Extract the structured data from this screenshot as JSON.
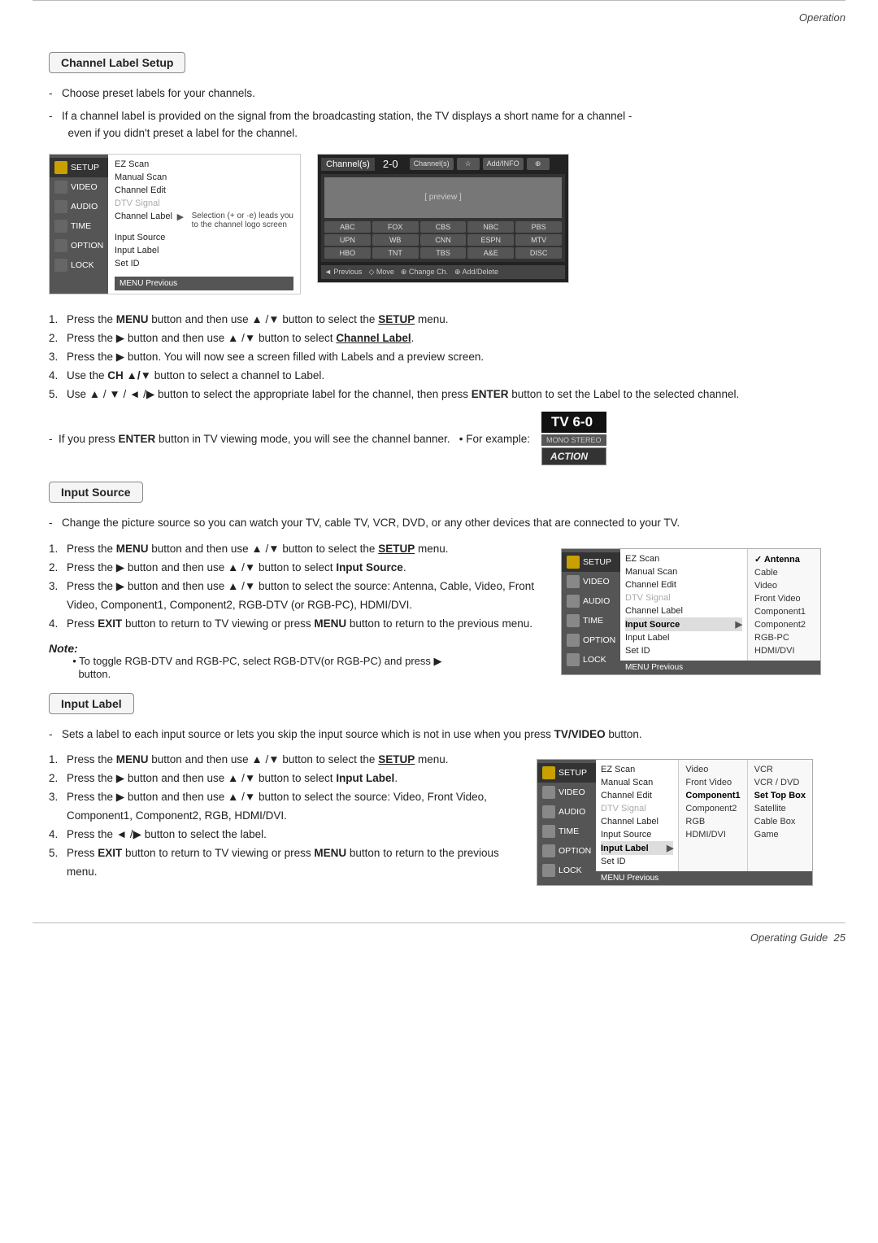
{
  "header": {
    "operation_label": "Operation"
  },
  "footer": {
    "page_label": "Operating Guide",
    "page_number": "25"
  },
  "channel_label_setup": {
    "title": "Channel Label Setup",
    "bullets": [
      "Choose preset labels for your channels.",
      "If a channel label is provided on the signal from the broadcasting station, the TV displays a short name for a channel - even if you didn't preset a label for the channel."
    ],
    "menu_sidebar_items": [
      {
        "label": "SETUP",
        "icon": "setup",
        "active": true
      },
      {
        "label": "VIDEO",
        "icon": "video"
      },
      {
        "label": "AUDIO",
        "icon": "audio"
      },
      {
        "label": "TIME",
        "icon": "time"
      },
      {
        "label": "OPTION",
        "icon": "option"
      },
      {
        "label": "LOCK",
        "icon": "lock"
      }
    ],
    "menu_items": [
      {
        "label": "EZ Scan",
        "dimmed": false
      },
      {
        "label": "Manual Scan",
        "dimmed": false
      },
      {
        "label": "Channel Edit",
        "dimmed": false
      },
      {
        "label": "DTV Signal",
        "dimmed": true
      },
      {
        "label": "Channel Label",
        "dimmed": false,
        "arrow": true,
        "note": "Selection (+ or -) leads you to the channel logo screen"
      },
      {
        "label": "Input Source",
        "dimmed": false
      },
      {
        "label": "Input Label",
        "dimmed": false
      },
      {
        "label": "Set ID",
        "dimmed": false
      }
    ],
    "menu_bottom": "MENU Previous",
    "steps": [
      {
        "num": "1.",
        "text": "Press the ",
        "bold_parts": [
          "MENU"
        ],
        "rest": " button and then use ▲ /▼ button to select the ",
        "bold_end": "SETUP",
        "end": " menu."
      },
      {
        "num": "2.",
        "text": "Press the ▶ button and then use ▲ /▼ button to select ",
        "bold_end": "Channel Label",
        "end": "."
      },
      {
        "num": "3.",
        "text": "Press the ▶ button. You will now see a screen filled with Labels and a preview screen."
      },
      {
        "num": "4.",
        "text": "Use the ",
        "bold_parts": [
          "CH ▲/▼"
        ],
        "rest": " button to select a channel to Label."
      },
      {
        "num": "5.",
        "text": "Use ▲ / ▼ / ◄ /▶ button to select the appropriate label for the channel, then press ",
        "bold_end": "ENTER",
        "end": " button to set the Label to the selected channel."
      }
    ],
    "enter_note": "If you press ENTER button in TV viewing mode, you will see the channel banner.    • For example:",
    "tv_example": "TV 6-0",
    "tv_mono_stereo": "MONO STEREO",
    "tv_action": "ACTION"
  },
  "input_source": {
    "title": "Input Source",
    "bullet": "Change the picture source so you can watch your TV, cable TV, VCR, DVD, or any other devices that are connected to your TV.",
    "steps": [
      "Press the MENU button and then use ▲ /▼ button to select the SETUP menu.",
      "Press the ▶ button and then use ▲ /▼ button to select Input Source.",
      "Press the ▶ button and then use ▲ /▼ button to select the source: Antenna, Cable, Video, Front Video, Component1, Component2, RGB-DTV (or RGB-PC), HDMI/DVI.",
      "Press EXIT button to return to TV viewing or press MENU button to return to the previous menu."
    ],
    "note_label": "Note:",
    "note_text": "• To toggle RGB-DTV and RGB-PC, select RGB-DTV(or RGB-PC) and press ▶ button.",
    "menu_sidebar_items": [
      {
        "label": "SETUP",
        "icon": "setup",
        "active": true
      },
      {
        "label": "VIDEO",
        "icon": "video"
      },
      {
        "label": "AUDIO",
        "icon": "audio"
      },
      {
        "label": "TIME",
        "icon": "time"
      },
      {
        "label": "OPTION",
        "icon": "option"
      },
      {
        "label": "LOCK",
        "icon": "lock"
      }
    ],
    "menu_items": [
      {
        "label": "EZ Scan"
      },
      {
        "label": "Manual Scan"
      },
      {
        "label": "Channel Edit"
      },
      {
        "label": "DTV Signal",
        "dimmed": true
      },
      {
        "label": "Channel Label"
      },
      {
        "label": "Input Source",
        "highlighted": true,
        "arrow": true
      },
      {
        "label": "Input Label"
      },
      {
        "label": "Set ID"
      }
    ],
    "options": [
      {
        "label": "✓ Antenna",
        "checked": true
      },
      {
        "label": "Cable"
      },
      {
        "label": "Video"
      },
      {
        "label": "Front Video"
      },
      {
        "label": "Component1"
      },
      {
        "label": "Component2"
      },
      {
        "label": "RGB-PC"
      },
      {
        "label": "HDMI/DVI"
      }
    ],
    "menu_bottom": "MENU Previous"
  },
  "input_label": {
    "title": "Input Label",
    "bullets": [
      "Sets a label to each input source or lets you skip the input source which is not in use when you press TV/VIDEO button."
    ],
    "steps": [
      "Press the MENU button and then use ▲ /▼ button to select the SETUP menu.",
      "Press the ▶ button and then use ▲ /▼ button to select Input Label.",
      "Press the ▶ button and then use ▲ /▼ button to select the source: Video, Front Video, Component1, Component2, RGB, HDMI/DVI.",
      "Press the ◄ /▶ button to select the label.",
      "Press EXIT button to return to TV viewing or press MENU button to return to the previous menu."
    ],
    "menu_sidebar_items": [
      {
        "label": "SETUP",
        "icon": "setup",
        "active": true
      },
      {
        "label": "VIDEO",
        "icon": "video"
      },
      {
        "label": "AUDIO",
        "icon": "audio"
      },
      {
        "label": "TIME",
        "icon": "time"
      },
      {
        "label": "OPTION",
        "icon": "option"
      },
      {
        "label": "LOCK",
        "icon": "lock"
      }
    ],
    "menu_items": [
      {
        "label": "EZ Scan"
      },
      {
        "label": "Manual Scan"
      },
      {
        "label": "Channel Edit"
      },
      {
        "label": "DTV Signal",
        "dimmed": true
      },
      {
        "label": "Channel Label"
      },
      {
        "label": "Input Source"
      },
      {
        "label": "Input Label",
        "highlighted": true,
        "arrow": true
      },
      {
        "label": "Set ID"
      }
    ],
    "sources": [
      {
        "label": "Video"
      },
      {
        "label": "Front Video"
      },
      {
        "label": "Component1"
      },
      {
        "label": "Component2"
      },
      {
        "label": "RGB"
      },
      {
        "label": "HDMI/DVI"
      }
    ],
    "options": [
      {
        "label": "VCR"
      },
      {
        "label": "VCR / DVD"
      },
      {
        "label": "Set Top Box"
      },
      {
        "label": "Satellite"
      },
      {
        "label": "Cable Box"
      },
      {
        "label": "Game"
      }
    ],
    "menu_bottom": "MENU Previous"
  }
}
